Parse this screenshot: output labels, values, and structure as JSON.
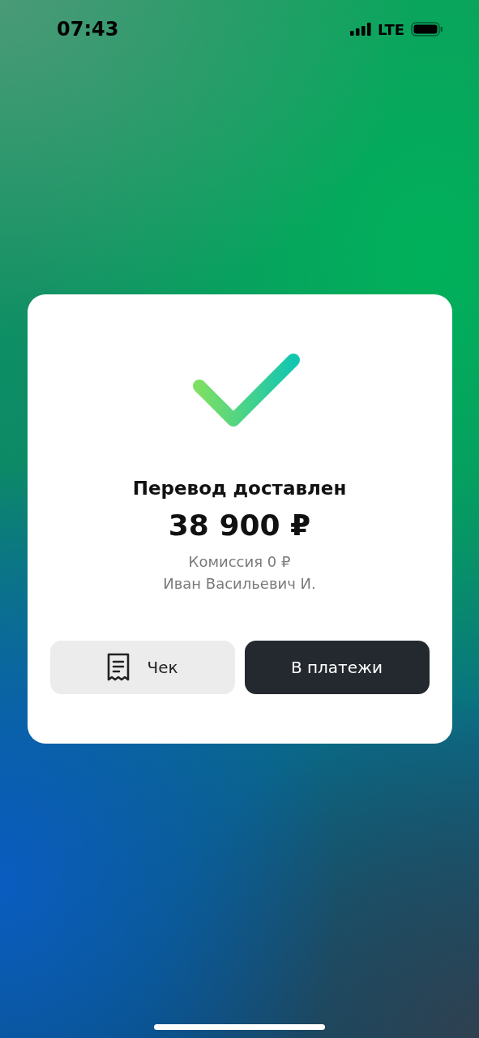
{
  "status_bar": {
    "time": "07:43",
    "network": "LTE"
  },
  "result": {
    "title": "Перевод доставлен",
    "amount": "38 900 ₽",
    "details": [
      "Комиссия 0 ₽",
      "Иван Васильевич И."
    ]
  },
  "buttons": [
    {
      "label": "Чек",
      "kind": "receipt"
    },
    {
      "label": "В платежи",
      "kind": "primary"
    }
  ]
}
